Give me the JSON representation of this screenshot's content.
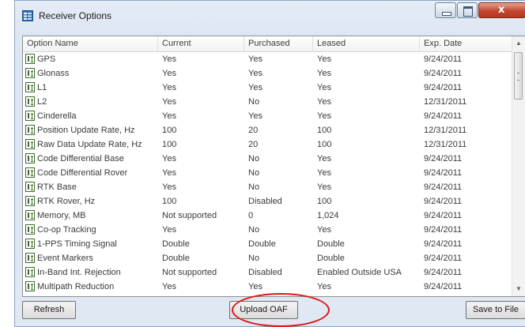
{
  "window": {
    "title": "Receiver Options",
    "minimize_icon": "minimize-icon",
    "maximize_icon": "maximize-icon",
    "close_icon": "close-icon",
    "close_glyph": "x"
  },
  "columns": [
    "Option Name",
    "Current",
    "Purchased",
    "Leased",
    "Exp. Date"
  ],
  "rows": [
    [
      "GPS",
      "Yes",
      "Yes",
      "Yes",
      "9/24/2011"
    ],
    [
      "Glonass",
      "Yes",
      "Yes",
      "Yes",
      "9/24/2011"
    ],
    [
      "L1",
      "Yes",
      "Yes",
      "Yes",
      "9/24/2011"
    ],
    [
      "L2",
      "Yes",
      "No",
      "Yes",
      "12/31/2011"
    ],
    [
      "Cinderella",
      "Yes",
      "Yes",
      "Yes",
      "9/24/2011"
    ],
    [
      "Position Update Rate, Hz",
      "100",
      "20",
      "100",
      "12/31/2011"
    ],
    [
      "Raw Data Update Rate, Hz",
      "100",
      "20",
      "100",
      "12/31/2011"
    ],
    [
      "Code Differential Base",
      "Yes",
      "No",
      "Yes",
      "9/24/2011"
    ],
    [
      "Code Differential Rover",
      "Yes",
      "No",
      "Yes",
      "9/24/2011"
    ],
    [
      "RTK Base",
      "Yes",
      "No",
      "Yes",
      "9/24/2011"
    ],
    [
      "RTK Rover, Hz",
      "100",
      "Disabled",
      "100",
      "9/24/2011"
    ],
    [
      "Memory, MB",
      "Not supported",
      "0",
      "1,024",
      "9/24/2011"
    ],
    [
      "Co-op Tracking",
      "Yes",
      "No",
      "Yes",
      "9/24/2011"
    ],
    [
      "1-PPS Timing Signal",
      "Double",
      "Double",
      "Double",
      "9/24/2011"
    ],
    [
      "Event Markers",
      "Double",
      "No",
      "Double",
      "9/24/2011"
    ],
    [
      "In-Band Int. Rejection",
      "Not supported",
      "Disabled",
      "Enabled Outside USA",
      "9/24/2011"
    ],
    [
      "Multipath Reduction",
      "Yes",
      "Yes",
      "Yes",
      "9/24/2011"
    ]
  ],
  "row_icon": "option-document-icon",
  "buttons": {
    "refresh": "Refresh",
    "upload": "Upload OAF",
    "save": "Save to File"
  },
  "annotation": {
    "shape": "red-ellipse-highlight",
    "target": "upload-oaf-button",
    "color": "#e01515"
  }
}
